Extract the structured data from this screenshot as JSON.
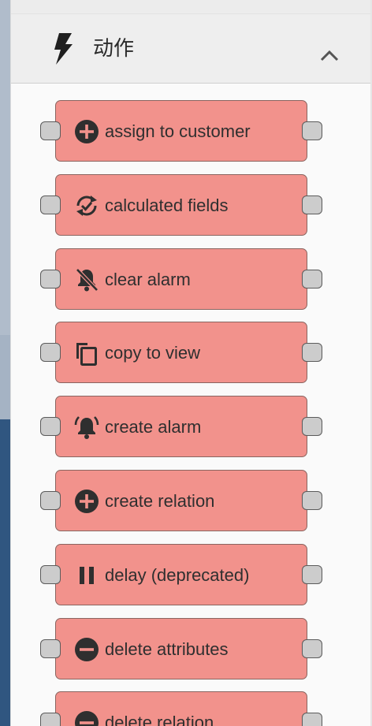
{
  "section": {
    "title": "动作",
    "icon": "bolt-icon",
    "expanded": true,
    "toggle_icon": "chevron-up-icon"
  },
  "colors": {
    "node_fill": "#f2928c",
    "node_border": "#8a6560",
    "port_fill": "#cccccc",
    "icon": "#2f2f2f"
  },
  "nodes": [
    {
      "label": "assign to customer",
      "icon": "add-circle-icon"
    },
    {
      "label": "calculated fields",
      "icon": "sync-check-icon"
    },
    {
      "label": "clear alarm",
      "icon": "notifications-off-icon"
    },
    {
      "label": "copy to view",
      "icon": "content-copy-icon"
    },
    {
      "label": "create alarm",
      "icon": "notifications-active-icon"
    },
    {
      "label": "create relation",
      "icon": "add-circle-icon"
    },
    {
      "label": "delay (deprecated)",
      "icon": "pause-icon"
    },
    {
      "label": "delete attributes",
      "icon": "remove-circle-icon"
    },
    {
      "label": "delete relation",
      "icon": "remove-circle-icon"
    }
  ]
}
